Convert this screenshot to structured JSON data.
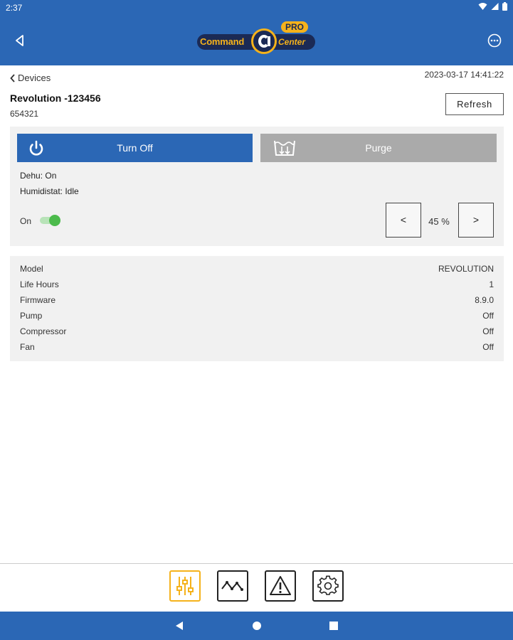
{
  "status_bar": {
    "time": "2:37"
  },
  "app_bar": {
    "logo_pro": "PRO",
    "logo_command": "Command",
    "logo_center": "Center"
  },
  "header": {
    "back_label": "Devices",
    "timestamp": "2023-03-17 14:41:22",
    "device_name": "Revolution -123456",
    "device_id": "654321",
    "refresh_label": "Refresh"
  },
  "controls": {
    "turn_off_label": "Turn Off",
    "purge_label": "Purge",
    "dehu_status": "Dehu: On",
    "humidistat_status": "Humidistat: Idle",
    "toggle_label": "On",
    "toggle_on": true,
    "decrement_label": "<",
    "increment_label": ">",
    "percent_value": "45 %"
  },
  "info": [
    {
      "key": "Model",
      "value": "REVOLUTION"
    },
    {
      "key": "Life Hours",
      "value": "1"
    },
    {
      "key": "Firmware",
      "value": "8.9.0"
    },
    {
      "key": "Pump",
      "value": "Off"
    },
    {
      "key": "Compressor",
      "value": "Off"
    },
    {
      "key": "Fan",
      "value": "Off"
    }
  ],
  "tabs": [
    {
      "icon": "sliders-icon",
      "active": true
    },
    {
      "icon": "trend-icon",
      "active": false
    },
    {
      "icon": "warning-icon",
      "active": false
    },
    {
      "icon": "gear-icon",
      "active": false
    }
  ],
  "colors": {
    "brand_blue": "#2b67b5",
    "purge_gray": "#aaaaaa",
    "accent_yellow": "#f5b21b",
    "toggle_green": "#4cbb4c"
  }
}
